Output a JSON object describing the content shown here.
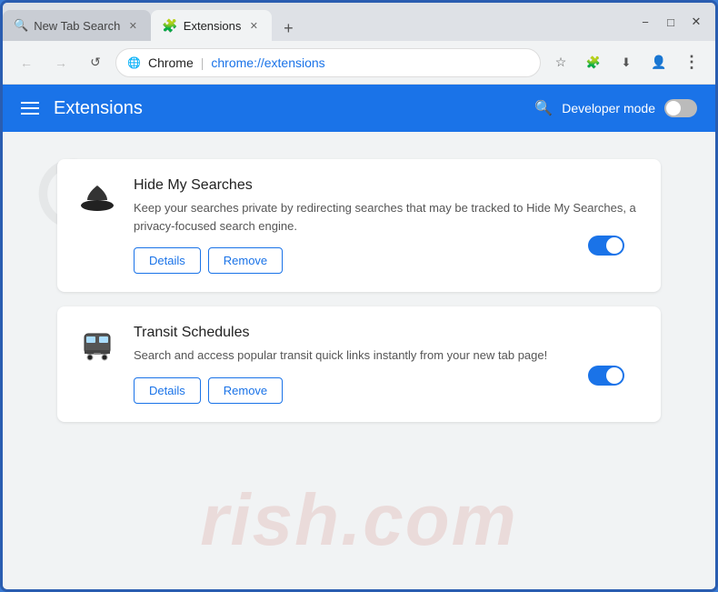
{
  "browser": {
    "tabs": [
      {
        "id": "tab-1",
        "title": "New Tab Search",
        "active": false,
        "icon": "search"
      },
      {
        "id": "tab-2",
        "title": "Extensions",
        "active": true,
        "icon": "puzzle"
      }
    ],
    "new_tab_label": "+",
    "window_controls": {
      "minimize": "−",
      "maximize": "□",
      "close": "✕"
    },
    "address_bar": {
      "icon": "🌐",
      "site": "Chrome",
      "divider": "|",
      "url": "chrome://extensions"
    },
    "nav": {
      "back": "←",
      "forward": "→",
      "reload": "↺",
      "bookmark": "☆",
      "profile": "👤"
    }
  },
  "extensions_page": {
    "header": {
      "menu_icon": "☰",
      "title": "Extensions",
      "search_icon": "🔍",
      "developer_mode_label": "Developer mode",
      "toggle_state": false
    },
    "extensions": [
      {
        "id": "ext-1",
        "name": "Hide My Searches",
        "description": "Keep your searches private by redirecting searches that may be tracked to Hide My Searches, a privacy-focused search engine.",
        "enabled": true,
        "details_label": "Details",
        "remove_label": "Remove",
        "icon_type": "hat"
      },
      {
        "id": "ext-2",
        "name": "Transit Schedules",
        "description": "Search and access popular transit quick links instantly from your new tab page!",
        "enabled": true,
        "details_label": "Details",
        "remove_label": "Remove",
        "icon_type": "bus"
      }
    ],
    "watermark": "rish.com"
  }
}
